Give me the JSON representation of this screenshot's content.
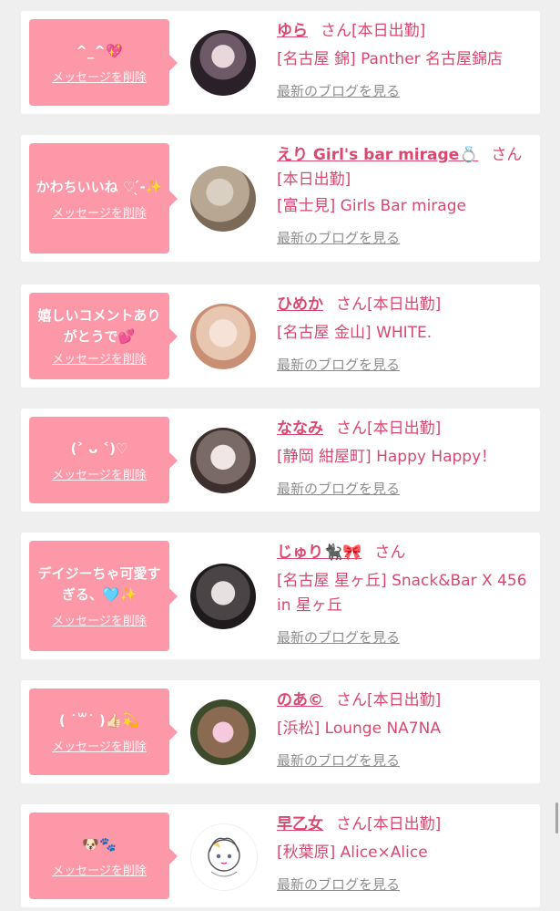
{
  "delete_label": "メッセージを削除",
  "blog_label": "最新のブログを見る",
  "san_label": "さん",
  "cards": [
    {
      "message": "^_^💖",
      "name": "ゆら",
      "status": "[本日出勤]",
      "shop": "[名古屋 錦] Panther 名古屋錦店"
    },
    {
      "message": "かわちいいね ♡ ̖́-✨",
      "name": "えり Girl's bar mirage💍",
      "status": "[本日出勤]",
      "shop": "[富士見] Girls Bar mirage"
    },
    {
      "message": "嬉しいコメントありがとうで💕",
      "name": "ひめか",
      "status": "[本日出勤]",
      "shop": "[名古屋 金山] WHITE."
    },
    {
      "message": "(˃ ᴗ ˂)♡",
      "name": "ななみ",
      "status": "[本日出勤]",
      "shop": "[静岡 紺屋町] Happy Happy！"
    },
    {
      "message": "デイジーちゃ可愛すぎる、🩵✨",
      "name": "じゅり🐈‍⬛🎀",
      "status": "",
      "shop": "[名古屋 星ヶ丘] Snack&Bar X 456 in 星ヶ丘"
    },
    {
      "message": "( ˙꒳˙ )👍🏻💫",
      "name": "のあ©",
      "status": "[本日出勤]",
      "shop": "[浜松] Lounge NA7NA"
    },
    {
      "message": "🐶🐾",
      "name": "早乙女",
      "status": "[本日出勤]",
      "shop": "[秋葉原] Alice×Alice"
    }
  ],
  "colors": {
    "accent": "#d94871",
    "bubble": "#fd98a8",
    "background": "#efefef"
  }
}
